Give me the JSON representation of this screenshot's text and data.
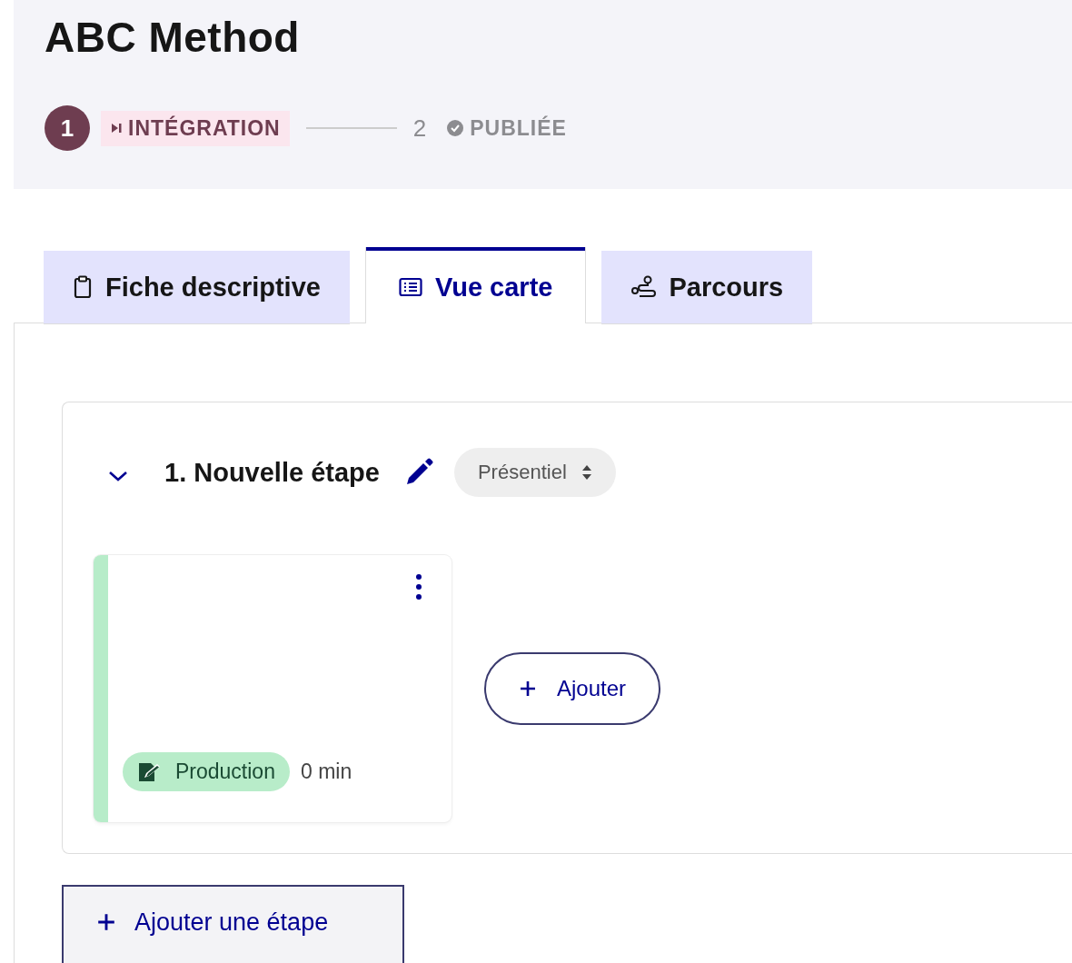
{
  "header": {
    "title": "ABC Method",
    "steps": [
      {
        "number": "1",
        "label": "INTÉGRATION",
        "kind": "current",
        "selected": true
      },
      {
        "number": "2",
        "label": "PUBLIÉE",
        "kind": "done",
        "selected": false
      }
    ]
  },
  "tabs": [
    {
      "label": "Fiche descriptive",
      "kind": "clipboard",
      "selected": false
    },
    {
      "label": "Vue carte",
      "kind": "list",
      "selected": true
    },
    {
      "label": "Parcours",
      "kind": "route",
      "selected": false
    }
  ],
  "section": {
    "title": "1. Nouvelle étape",
    "expanded": true,
    "mode": "Présentiel",
    "cards": [
      {
        "tag": "Production",
        "duration": "0 min"
      }
    ],
    "add_button": "Ajouter"
  },
  "add_step_button": "Ajouter une étape"
}
